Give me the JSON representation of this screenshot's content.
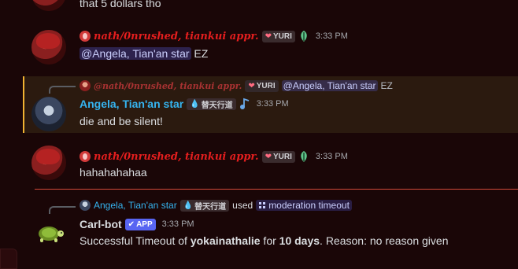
{
  "messages": {
    "top_fragment": {
      "text": "that 5 dollars tho"
    },
    "m1": {
      "author": "nath/0nrushed, tiankui appr.",
      "tag": "YURI",
      "time": "3:33 PM",
      "mention": "@Angela, Tian'an star",
      "text": "EZ"
    },
    "m2": {
      "reply": {
        "author": "@nath/0nrushed, tiankui appr.",
        "tag": "YURI",
        "mention": "@Angela, Tian'an star",
        "text": "EZ"
      },
      "author": "Angela, Tian'an star",
      "tag": "替天行道",
      "time": "3:33 PM",
      "text": "die and be silent!"
    },
    "m3": {
      "author": "nath/0nrushed, tiankui appr.",
      "tag": "YURI",
      "time": "3:33 PM",
      "text": "hahahahahaa"
    },
    "m4": {
      "reply": {
        "author": "Angela, Tian'an star",
        "tag": "替天行道",
        "used": "used",
        "command": "moderation timeout"
      },
      "author": "Carl-bot",
      "app_tag": "APP",
      "time": "3:33 PM",
      "text_pre": "Successful Timeout of ",
      "user": "yokainathalie",
      "text_mid": " for ",
      "duration": "10 days",
      "text_post": ". Reason: no reason given"
    }
  },
  "colors": {
    "background": "#1a0607",
    "nath_name": "#e41e1e",
    "angela_name": "#35b4f0",
    "highlight_bar": "#f0b232",
    "divider": "#d24a3a",
    "app_tag": "#5865f2"
  },
  "icons": [
    "role-heart-icon",
    "leaf-badge-icon",
    "water-drop-icon",
    "music-note-icon",
    "check-icon",
    "slash-command-icon",
    "turtle-avatar-icon"
  ]
}
